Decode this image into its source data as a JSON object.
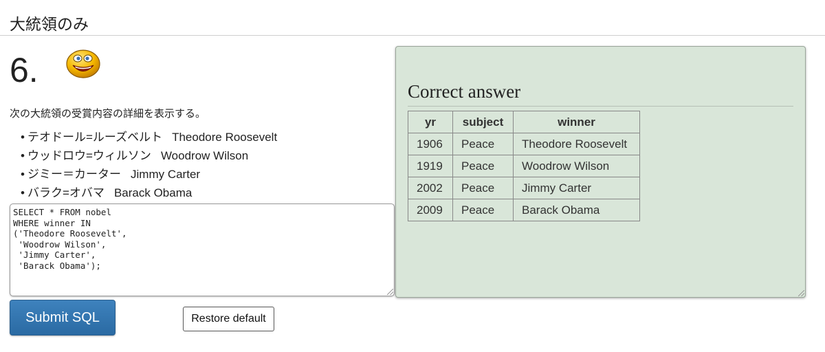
{
  "section_title": "大統領のみ",
  "question": {
    "number": "6.",
    "instruction": "次の大統領の受賞内容の詳細を表示する。",
    "presidents": [
      {
        "jp": "テオドール=ルーズベルト",
        "en": "Theodore Roosevelt"
      },
      {
        "jp": "ウッドロウ=ウィルソン",
        "en": "Woodrow Wilson"
      },
      {
        "jp": "ジミー＝カーター",
        "en": "Jimmy Carter"
      },
      {
        "jp": "バラク=オバマ",
        "en": "Barack Obama"
      }
    ],
    "status_icon": "smiley-face-icon"
  },
  "editor": {
    "sql": "SELECT * FROM nobel\nWHERE winner IN\n('Theodore Roosevelt',\n 'Woodrow Wilson',\n 'Jimmy Carter',\n 'Barack Obama');"
  },
  "buttons": {
    "submit_label": "Submit SQL",
    "restore_label": "Restore default"
  },
  "answer": {
    "title": "Correct answer",
    "columns": [
      "yr",
      "subject",
      "winner"
    ],
    "rows": [
      [
        "1906",
        "Peace",
        "Theodore Roosevelt"
      ],
      [
        "1919",
        "Peace",
        "Woodrow Wilson"
      ],
      [
        "2002",
        "Peace",
        "Jimmy Carter"
      ],
      [
        "2009",
        "Peace",
        "Barack Obama"
      ]
    ]
  },
  "colors": {
    "panel_background": "#d9e6d9",
    "submit_button": "#3278b3",
    "smiley_fill": "#f5b800"
  }
}
